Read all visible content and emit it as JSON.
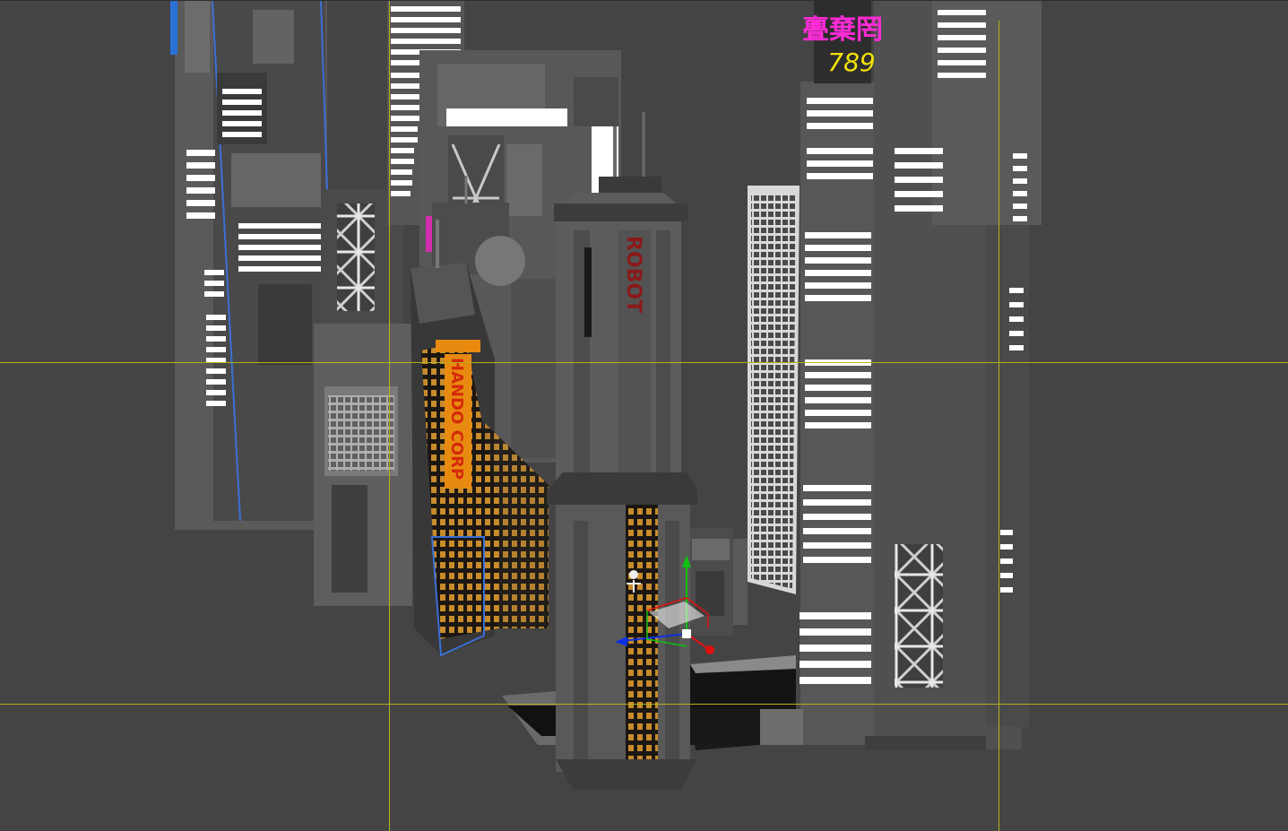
{
  "viewport": {
    "background": "#444444",
    "guide_color": "#b5b01e",
    "projection": "perspective"
  },
  "scene": {
    "signs": {
      "neon_top": "亹棄罔",
      "neon_number": "789",
      "hando_sign": "HANDO CORP",
      "red_vertical": "ROBOT"
    },
    "colors": {
      "concrete": "#5b5b5b",
      "concrete_dark": "#3c3c3c",
      "concrete_light": "#7a7a7a",
      "window_white": "#ffffff",
      "neon_magenta": "#ff2bd6",
      "neon_yellow": "#f2e20a",
      "orange_sign": "#e88a10",
      "warm_window": "#d7962e",
      "blue_trim": "#3b6fd6"
    }
  },
  "gizmo": {
    "icons": [
      "move-gizmo-icon",
      "light-object-icon"
    ],
    "axis_colors": {
      "x": "#e01010",
      "y": "#10c010",
      "z": "#1030e0"
    }
  }
}
